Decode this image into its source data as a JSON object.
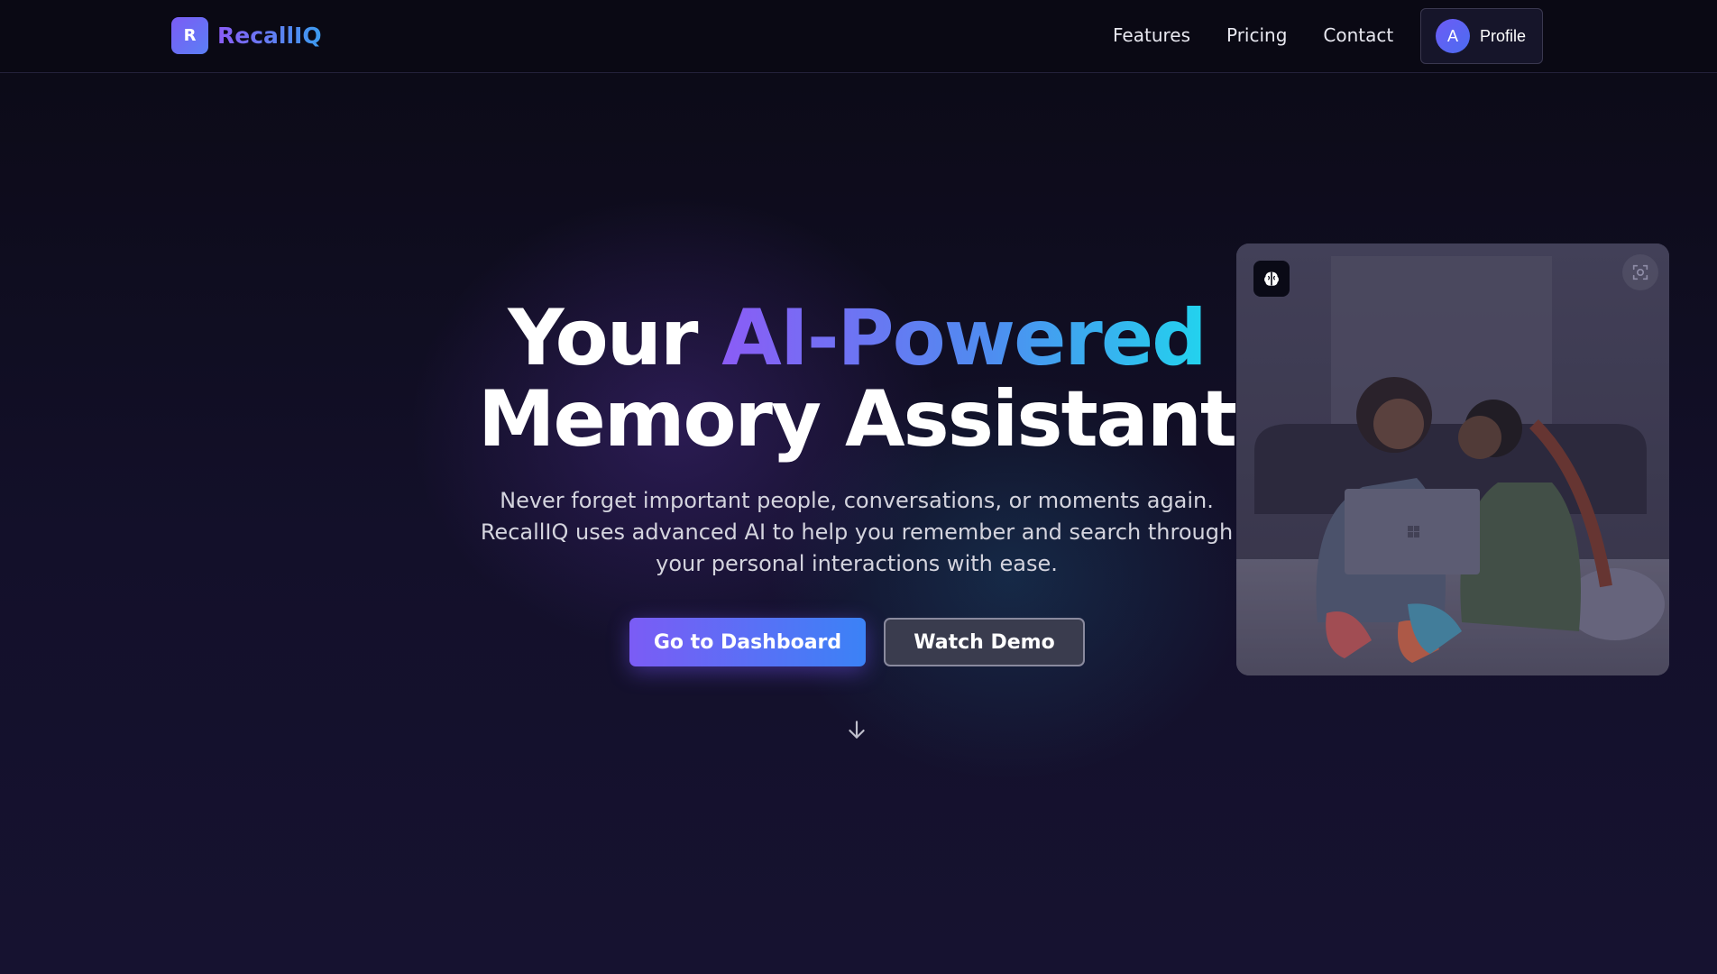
{
  "brand": {
    "logo_letter": "R",
    "name": "RecallIQ"
  },
  "nav": {
    "links": [
      "Features",
      "Pricing",
      "Contact"
    ],
    "profile": {
      "avatar_letter": "A",
      "label": "Profile"
    }
  },
  "hero": {
    "title_plain_1": "Your ",
    "title_highlight": "AI-Powered",
    "title_line_2": "Memory Assistant",
    "subtitle": "Never forget important people, conversations, or moments again. RecallIQ uses advanced AI to help you remember and search through your personal interactions with ease.",
    "primary_button": "Go to Dashboard",
    "secondary_button": "Watch Demo",
    "scroll_icon": "arrow-down-icon"
  },
  "photo_card": {
    "badge_icon": "brain-icon",
    "action_icon": "scan-icon"
  },
  "colors": {
    "accent_purple": "#8b5cf6",
    "accent_blue": "#3b82f6",
    "accent_cyan": "#22d3ee",
    "background": "#0e0c1a"
  }
}
